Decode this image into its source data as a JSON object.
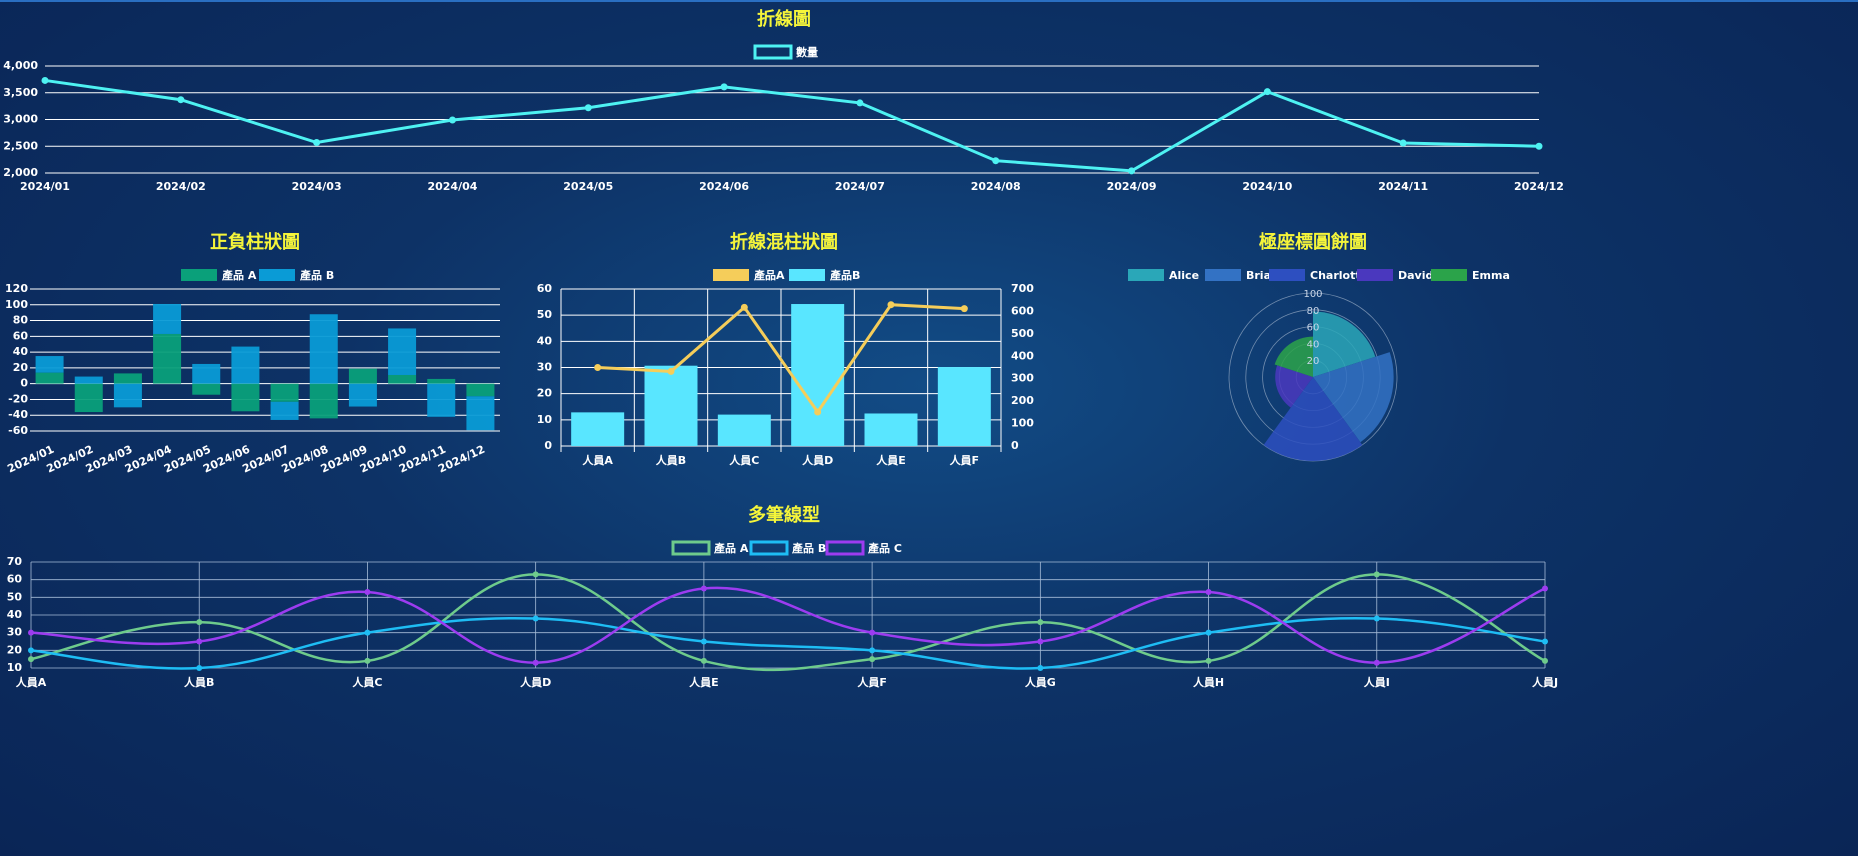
{
  "colors": {
    "title": "#f5f53a",
    "text": "#ffffff",
    "grid": "#ffffff",
    "line_cyan": "#4ef2f2",
    "bar_green": "#0aa07a",
    "bar_blue": "#0a9bd6",
    "mixed_bar": "#59e6ff",
    "mixed_line": "#f5cd5a",
    "multi_a": "#6ecb8c",
    "multi_b": "#1ebdf4",
    "multi_c": "#9c3cf0",
    "polar": [
      "#2aa7b8",
      "#3372c4",
      "#2d4fc0",
      "#4a38be",
      "#2ba34a"
    ]
  },
  "chart_data": [
    {
      "id": "line",
      "type": "line",
      "title": "折線圖",
      "categories": [
        "2024/01",
        "2024/02",
        "2024/03",
        "2024/04",
        "2024/05",
        "2024/06",
        "2024/07",
        "2024/08",
        "2024/09",
        "2024/10",
        "2024/11",
        "2024/12"
      ],
      "series": [
        {
          "name": "數量",
          "values": [
            3730,
            3370,
            2570,
            2990,
            3220,
            3610,
            3310,
            2230,
            2040,
            3520,
            2560,
            2500
          ]
        }
      ],
      "ylim": [
        2000,
        4000
      ],
      "yticks": [
        "2,000",
        "2,500",
        "3,000",
        "3,500",
        "4,000"
      ],
      "legend": "top-center",
      "grid": true
    },
    {
      "id": "posneg",
      "type": "bar",
      "stacked": true,
      "title": "正負柱狀圖",
      "categories": [
        "2024/01",
        "2024/02",
        "2024/03",
        "2024/04",
        "2024/05",
        "2024/06",
        "2024/07",
        "2024/08",
        "2024/09",
        "2024/10",
        "2024/11",
        "2024/12"
      ],
      "series": [
        {
          "name": "產品 A",
          "values": [
            14,
            -36,
            13,
            63,
            -14,
            -35,
            -23,
            -44,
            19,
            11,
            6,
            -16
          ]
        },
        {
          "name": "產品 B",
          "values": [
            21,
            9,
            -30,
            38,
            25,
            47,
            -23,
            88,
            -29,
            59,
            -42,
            -43
          ]
        }
      ],
      "ylim": [
        -60,
        120
      ],
      "yticks": [
        "-60",
        "-40",
        "-20",
        "0",
        "20",
        "40",
        "60",
        "80",
        "100",
        "120"
      ],
      "legend": "top-center",
      "grid": true
    },
    {
      "id": "mixed",
      "type": "bar",
      "title": "折線混柱狀圖",
      "categories": [
        "人員A",
        "人員B",
        "人員C",
        "人員D",
        "人員E",
        "人員F"
      ],
      "series": [
        {
          "name": "產品A",
          "type": "line",
          "axis": "left",
          "values": [
            30,
            28.5,
            53,
            13,
            54,
            52.5
          ]
        },
        {
          "name": "產品B",
          "type": "bar",
          "axis": "right",
          "values": [
            150,
            358,
            140,
            633,
            145,
            352
          ]
        }
      ],
      "ylim_left": [
        0,
        60
      ],
      "ylim_right": [
        0,
        700
      ],
      "yticks_left": [
        "0",
        "10",
        "20",
        "30",
        "40",
        "50",
        "60"
      ],
      "yticks_right": [
        "0",
        "100",
        "200",
        "300",
        "400",
        "500",
        "600",
        "700"
      ],
      "legend": "top-center",
      "grid": true
    },
    {
      "id": "polar",
      "type": "pie",
      "subtype": "polar-area",
      "title": "極座標圓餅圖",
      "labels": [
        "Alice",
        "Brian",
        "Charlotte",
        "David",
        "Emma"
      ],
      "values": [
        78,
        96,
        100,
        45,
        48
      ],
      "rlim": [
        0,
        100
      ],
      "rticks": [
        "20",
        "40",
        "60",
        "80",
        "100"
      ],
      "legend": "top-center"
    },
    {
      "id": "multi",
      "type": "line",
      "smooth": true,
      "title": "多筆線型",
      "categories": [
        "人員A",
        "人員B",
        "人員C",
        "人員D",
        "人員E",
        "人員F",
        "人員G",
        "人員H",
        "人員I",
        "人員J"
      ],
      "series": [
        {
          "name": "產品 A",
          "values": [
            15,
            36,
            14,
            63,
            14,
            15,
            36,
            14,
            63,
            14
          ]
        },
        {
          "name": "產品 B",
          "values": [
            20,
            10,
            30,
            38,
            25,
            20,
            10,
            30,
            38,
            25
          ]
        },
        {
          "name": "產品 C",
          "values": [
            30,
            25,
            53,
            13,
            55,
            30,
            25,
            53,
            13,
            55
          ]
        }
      ],
      "ylim": [
        10,
        70
      ],
      "yticks": [
        "10",
        "20",
        "30",
        "40",
        "50",
        "60",
        "70"
      ],
      "legend": "top-center",
      "grid": true
    }
  ]
}
